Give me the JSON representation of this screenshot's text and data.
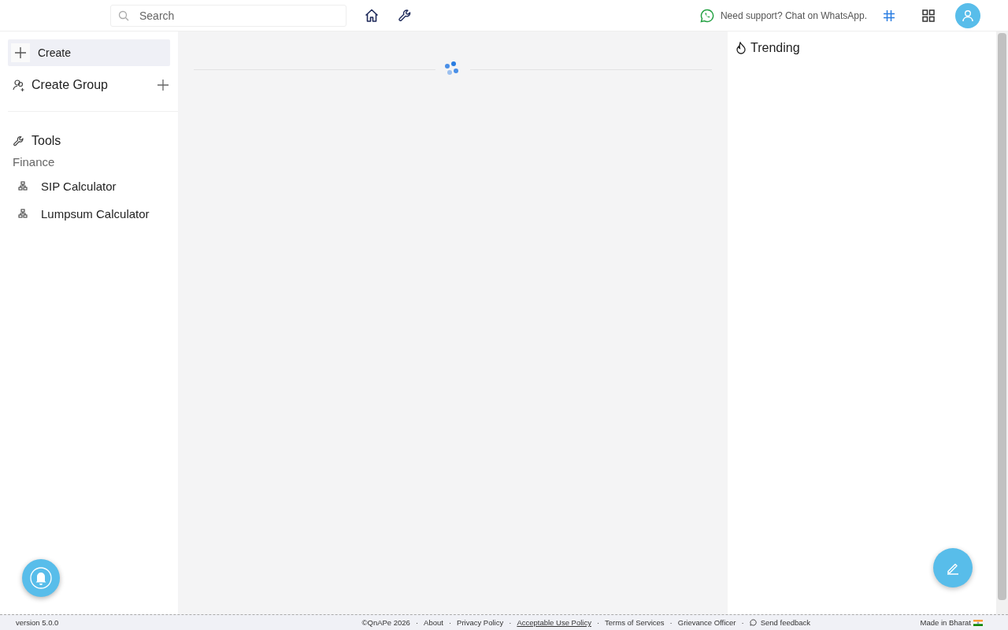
{
  "topbar": {
    "search": {
      "placeholder": "Search"
    },
    "support": "Need support? Chat on WhatsApp."
  },
  "sidebar": {
    "create": "Create",
    "create_group": "Create Group",
    "tools": "Tools",
    "sections": [
      {
        "title": "Finance",
        "items": [
          "SIP Calculator",
          "Lumpsum Calculator"
        ]
      }
    ]
  },
  "trending": {
    "title": "Trending"
  },
  "footer": {
    "version": "version 5.0.0",
    "separator": "·",
    "links": [
      {
        "label": "©QnAPe 2026",
        "kind": "text"
      },
      {
        "label": "About",
        "kind": "link"
      },
      {
        "label": "Privacy Policy",
        "kind": "link"
      },
      {
        "label": "Acceptable Use Policy",
        "kind": "underlined"
      },
      {
        "label": "Terms of Services",
        "kind": "link"
      },
      {
        "label": "Grievance Officer",
        "kind": "link"
      },
      {
        "label": "Send feedback",
        "kind": "feedback"
      }
    ],
    "made_in": "Made in Bharat"
  }
}
